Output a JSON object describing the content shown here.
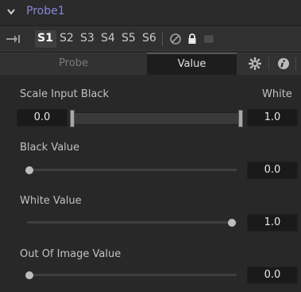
{
  "node": {
    "title": "Probe1"
  },
  "toolbar": {
    "slots": [
      "S1",
      "S2",
      "S3",
      "S4",
      "S5",
      "S6"
    ],
    "active_slot": "S1"
  },
  "tabs": [
    {
      "label": "Probe",
      "active": false
    },
    {
      "label": "Value",
      "active": true
    }
  ],
  "controls": {
    "scale_input_black": {
      "label": "Scale Input Black",
      "white_label": "White",
      "black_value": "0.0",
      "white_value": "1.0",
      "black_fraction": 0.0,
      "white_fraction": 1.0
    },
    "black_value": {
      "label": "Black Value",
      "value": "0.0",
      "fraction": 0.0
    },
    "white_value": {
      "label": "White Value",
      "value": "1.0",
      "fraction": 1.0
    },
    "out_of_image_value": {
      "label": "Out Of Image Value",
      "value": "0.0",
      "fraction": 0.0
    }
  },
  "colors": {
    "accent_title": "#8a84d8",
    "background": "#282828",
    "field_bg": "#1a1a1a"
  },
  "icons": [
    "collapse-chevron-icon",
    "pin-icon",
    "disable-icon",
    "lock-icon",
    "gray-square-icon",
    "gear-icon",
    "info-icon"
  ]
}
